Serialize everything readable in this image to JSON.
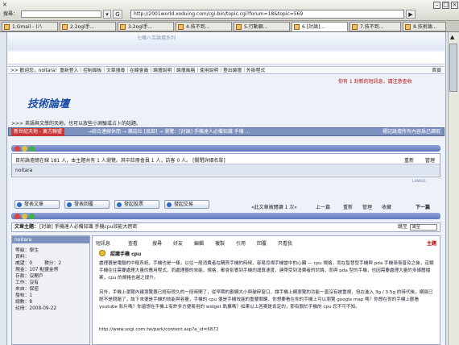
{
  "browser": {
    "search_label": "搜尋：",
    "search_value": "",
    "url": "http://2001world.xoduing.com/cgi-bin/topic.cgi?forum=18&topic=569",
    "tabs": [
      {
        "label": "1.Gmail - (八"
      },
      {
        "label": "2.2ogl手..."
      },
      {
        "label": "3.2ogl手..."
      },
      {
        "label": "4.技不到..."
      },
      {
        "label": "5.行動銀..."
      },
      {
        "label": "6.[討論]..."
      },
      {
        "label": "7.技不到..."
      },
      {
        "label": "8.技術論..."
      }
    ]
  },
  "forum": {
    "banner_text": "七嘴八舌論壇系列",
    "menu": ">> 歡迎您，noitara！重新登入｜控制面板｜文章搜尋｜在線會員｜論壇說明｜論壇風格｜使用說明｜登出論壇｜外掛程式",
    "home": "首頁",
    "new_msg": "你有 1 封新的短訊息，請注意查收",
    "logo": "技術論壇",
    "slogan": ">>> 英語與文學的天地，也可以放些小測驗或占卜的話題。",
    "crumb_lead": "新世紀天地 - 東方聯盟",
    "crumb_rest": "→綜合連線休閒 → 雜誌社 [底部] → 瀏覽：[討論] 手機達人必備知識  手機 ...",
    "crumb_right": "標記論壇所有內容爲已讀取",
    "online": "目前論壇總在線 181 人，本主題共有 1 人瀏覽。其中註冊會員 1 人，訪客 0 人。  [關閉詳細名單]",
    "online_user": "noitara",
    "refresh": "重新",
    "manage": "管理",
    "footer_logo": "LAIWOO",
    "buttons": [
      "發表文章",
      "發表回覆",
      "發起投票",
      "發起交易"
    ],
    "nav_right": "«此文章被閱讀 1 次»",
    "prev": "上一篇",
    "renew": "重新",
    "manage2": "管理",
    "collect": "收藏",
    "next": "下一篇",
    "topic_label": "文章主題：",
    "topic": "[討論] 手機達人必備知識  手機cpu效能大跨密",
    "goto": "跳至",
    "goto_value": "跳至",
    "user": {
      "name": "noitara",
      "lines": [
        "等級：學生",
        "資料：",
        "威望：0",
        "積分：2",
        "現金：107 點盟金幣",
        "存款：沒開戶",
        "工作：沒有",
        "來自：保密",
        "發帖：1",
        "總數：8",
        "註冊：2008-09-22"
      ]
    },
    "post_tools": [
      "短訊息",
      "查看",
      "搜尋",
      "好友",
      "編輯",
      "複製",
      "引用",
      "回覆",
      "只看我"
    ],
    "main_label": "主題",
    "post_title": "認識手機 cpu",
    "para1": "處理器是電腦的中樞系統，手機也是一樣，以往一般消費者在購買手機的時候，容易忽視手機當中的心臟 — cpu 規格，而在智慧型手機與 pda 手機漸漸普及之後，這類手機往往需要處理大量的應用程式，而處理器的效能，規格，都會影響到手機的運算速度，連帶受到消費者的討論，而與 pda 型的手機，也因需要處理大量的多媒體檔案，cpu 的規格也越之提升。",
    "para2": "另外，手機上瀏覽內建瀏覽器已經有很久的一段時間了，從早期的觀網大小與破碎窗口，讓手機上網瀏覽的功能一直沒有被重視，但在進入 3g / 3.5g 的時代後，網頁已經不是問題了，該下來便是手機的效能與容量，手機的 cpu 便是手機效能的重要關鍵，你想要看在你的手機上可以瀏覽 google map 嗎？你想在你的手機上觀看 youtube 影片嗎？你還想在手機上有許多方便易用的 widget 軌擴嗎？如果以上答案是肯定的，那有關於手機的 cpu 您不可不知。",
    "source": "http://www.sogi.com.tw/park/content.asp?a_id=6872"
  }
}
